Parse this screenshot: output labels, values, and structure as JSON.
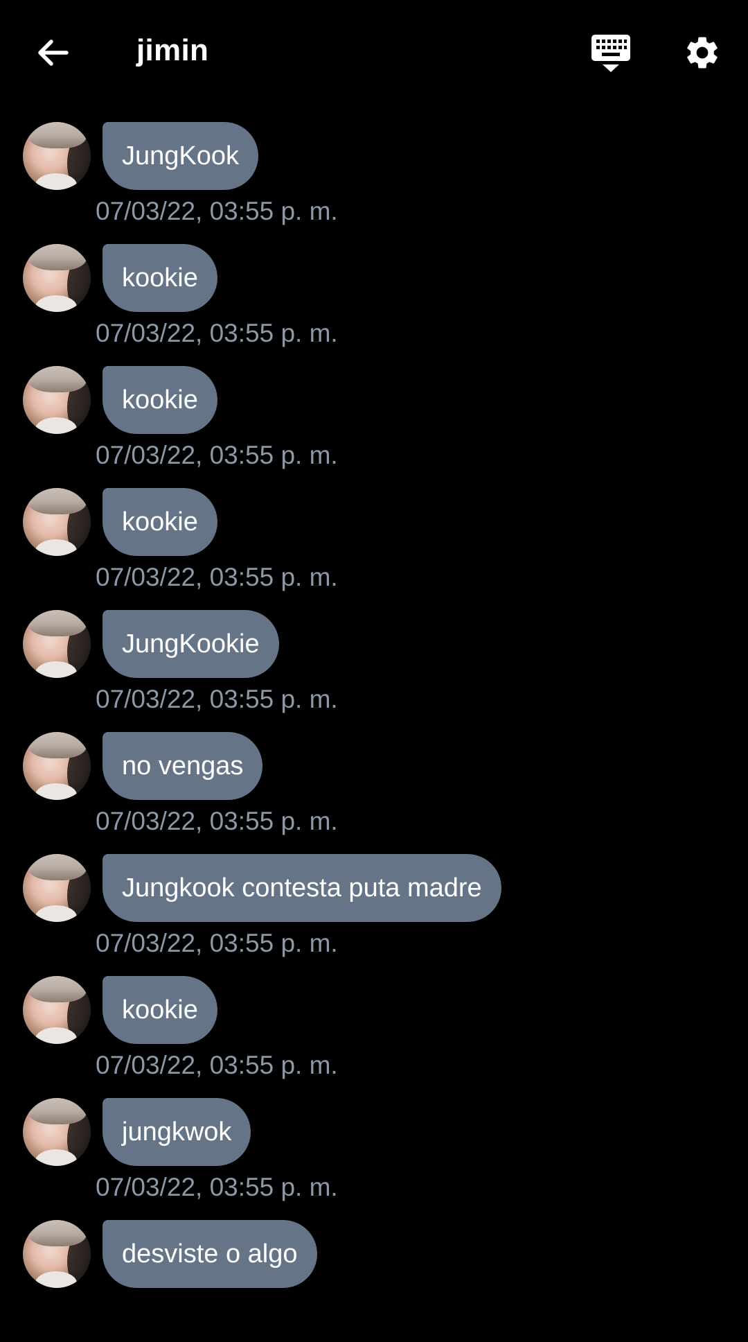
{
  "header": {
    "title": "jimin",
    "back_icon": "arrow-left-icon",
    "keyboard_icon": "keyboard-hide-icon",
    "settings_icon": "gear-icon"
  },
  "colors": {
    "background": "#000000",
    "bubble": "#657587",
    "timestamp": "#8d98a7",
    "text": "#ffffff"
  },
  "messages": [
    {
      "text": "JungKook",
      "time": "07/03/22, 03:55 p. m."
    },
    {
      "text": "kookie",
      "time": "07/03/22, 03:55 p. m."
    },
    {
      "text": "kookie",
      "time": "07/03/22, 03:55 p. m."
    },
    {
      "text": "kookie",
      "time": "07/03/22, 03:55 p. m."
    },
    {
      "text": "JungKookie",
      "time": "07/03/22, 03:55 p. m."
    },
    {
      "text": "no vengas",
      "time": "07/03/22, 03:55 p. m."
    },
    {
      "text": "Jungkook contesta puta madre",
      "time": "07/03/22, 03:55 p. m."
    },
    {
      "text": "kookie",
      "time": "07/03/22, 03:55 p. m."
    },
    {
      "text": "jungkwok",
      "time": "07/03/22, 03:55 p. m."
    },
    {
      "text": "desviste o algo",
      "time": ""
    }
  ]
}
